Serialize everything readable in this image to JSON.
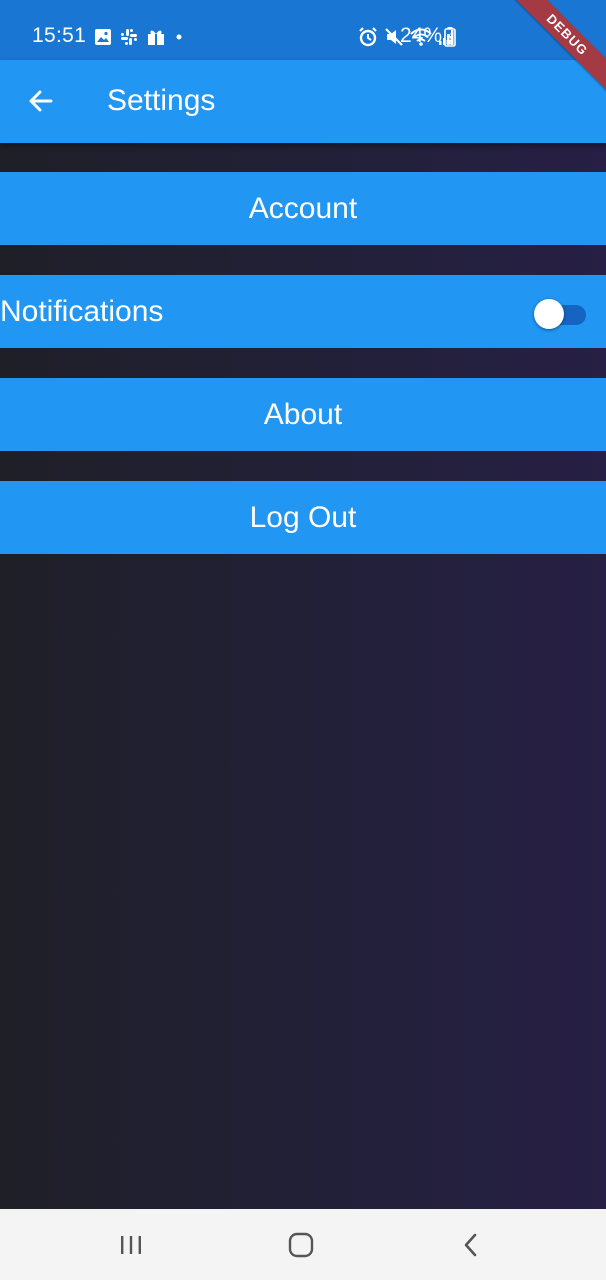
{
  "status_bar": {
    "time": "15:51",
    "battery": "24%",
    "left_icons": [
      "image-icon",
      "slack-icon",
      "gift-icon",
      "dot-icon"
    ],
    "right_icons": [
      "alarm-icon",
      "mute-icon",
      "wifi-icon",
      "signal-icon",
      "battery-charging-icon"
    ]
  },
  "debug_banner": "DEBUG",
  "app_bar": {
    "title": "Settings",
    "back_icon": "arrow-back-icon"
  },
  "settings": {
    "account": "Account",
    "notifications": {
      "label": "Notifications",
      "enabled": false
    },
    "about": "About",
    "logout": "Log Out"
  },
  "nav_bar": {
    "buttons": [
      "recent-apps-icon",
      "home-icon",
      "back-icon"
    ]
  },
  "colors": {
    "status_bar": "#1976d2",
    "app_bar": "#2196f3",
    "tile": "#2196f3",
    "background_dark": "#1f1f28",
    "nav_bar": "#f4f4f4"
  }
}
